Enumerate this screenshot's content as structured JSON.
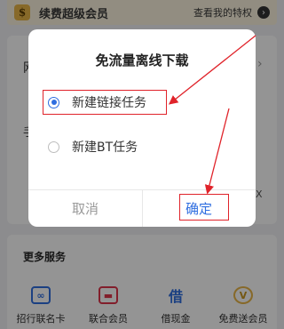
{
  "background": {
    "vip_banner": {
      "icon_letter": "$",
      "title": "续费超级会员",
      "link": "查看我的特权",
      "arrow_glyph": "›"
    },
    "card_fragments": {
      "left_char_1": "网",
      "left_char_2": "手",
      "right_chevron": "›",
      "right_char": "X"
    },
    "more_services": {
      "title": "更多服务",
      "items": [
        {
          "label": "招行联名卡",
          "icon": "card-icon",
          "icon_glyph": "∞",
          "color": "#2f6ee0"
        },
        {
          "label": "联合会员",
          "icon": "member-card-icon",
          "icon_glyph": "▬",
          "color": "#e0344a"
        },
        {
          "label": "借现金",
          "icon": "cash-icon",
          "icon_glyph": "借",
          "color": "#2f6ee0"
        },
        {
          "label": "免费送会员",
          "icon": "gift-vip-icon",
          "icon_glyph": "V",
          "color": "#e8b647"
        }
      ]
    }
  },
  "dialog": {
    "title": "免流量离线下载",
    "options": [
      {
        "label": "新建链接任务",
        "selected": true
      },
      {
        "label": "新建BT任务",
        "selected": false
      }
    ],
    "cancel_label": "取消",
    "confirm_label": "确定"
  },
  "colors": {
    "accent": "#2f6ee0",
    "annotation_red": "#e0232a",
    "overlay": "rgba(0,0,0,0.42)"
  }
}
